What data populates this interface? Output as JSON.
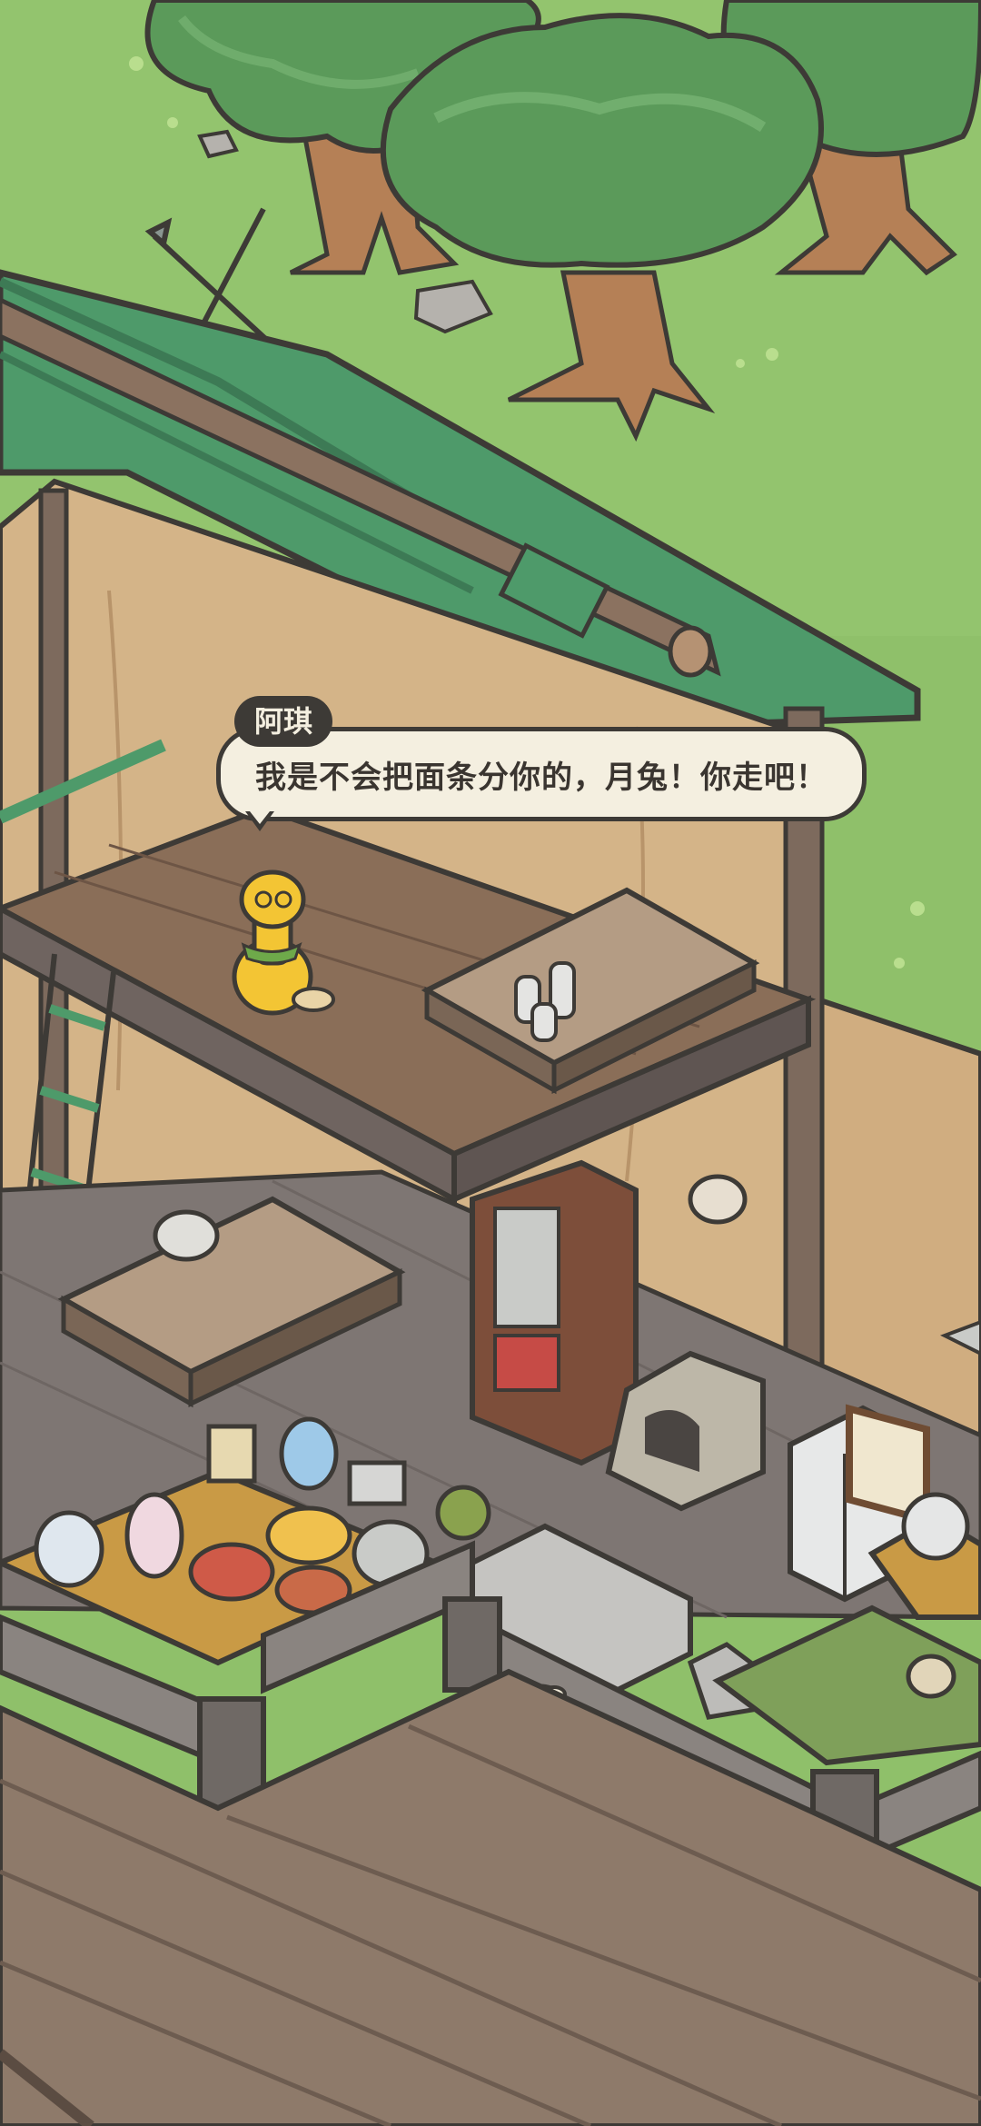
{
  "dialogue": {
    "speaker": "阿琪",
    "text": "我是不会把面条分你的，月兔！你走吧！"
  },
  "colors": {
    "grass": "#8fc06a",
    "roof": "#4e9a6a",
    "wood_wall": "#d4b488",
    "floor": "#7a6656",
    "bubble": "#f4efe0",
    "outline": "#3d3a36"
  }
}
